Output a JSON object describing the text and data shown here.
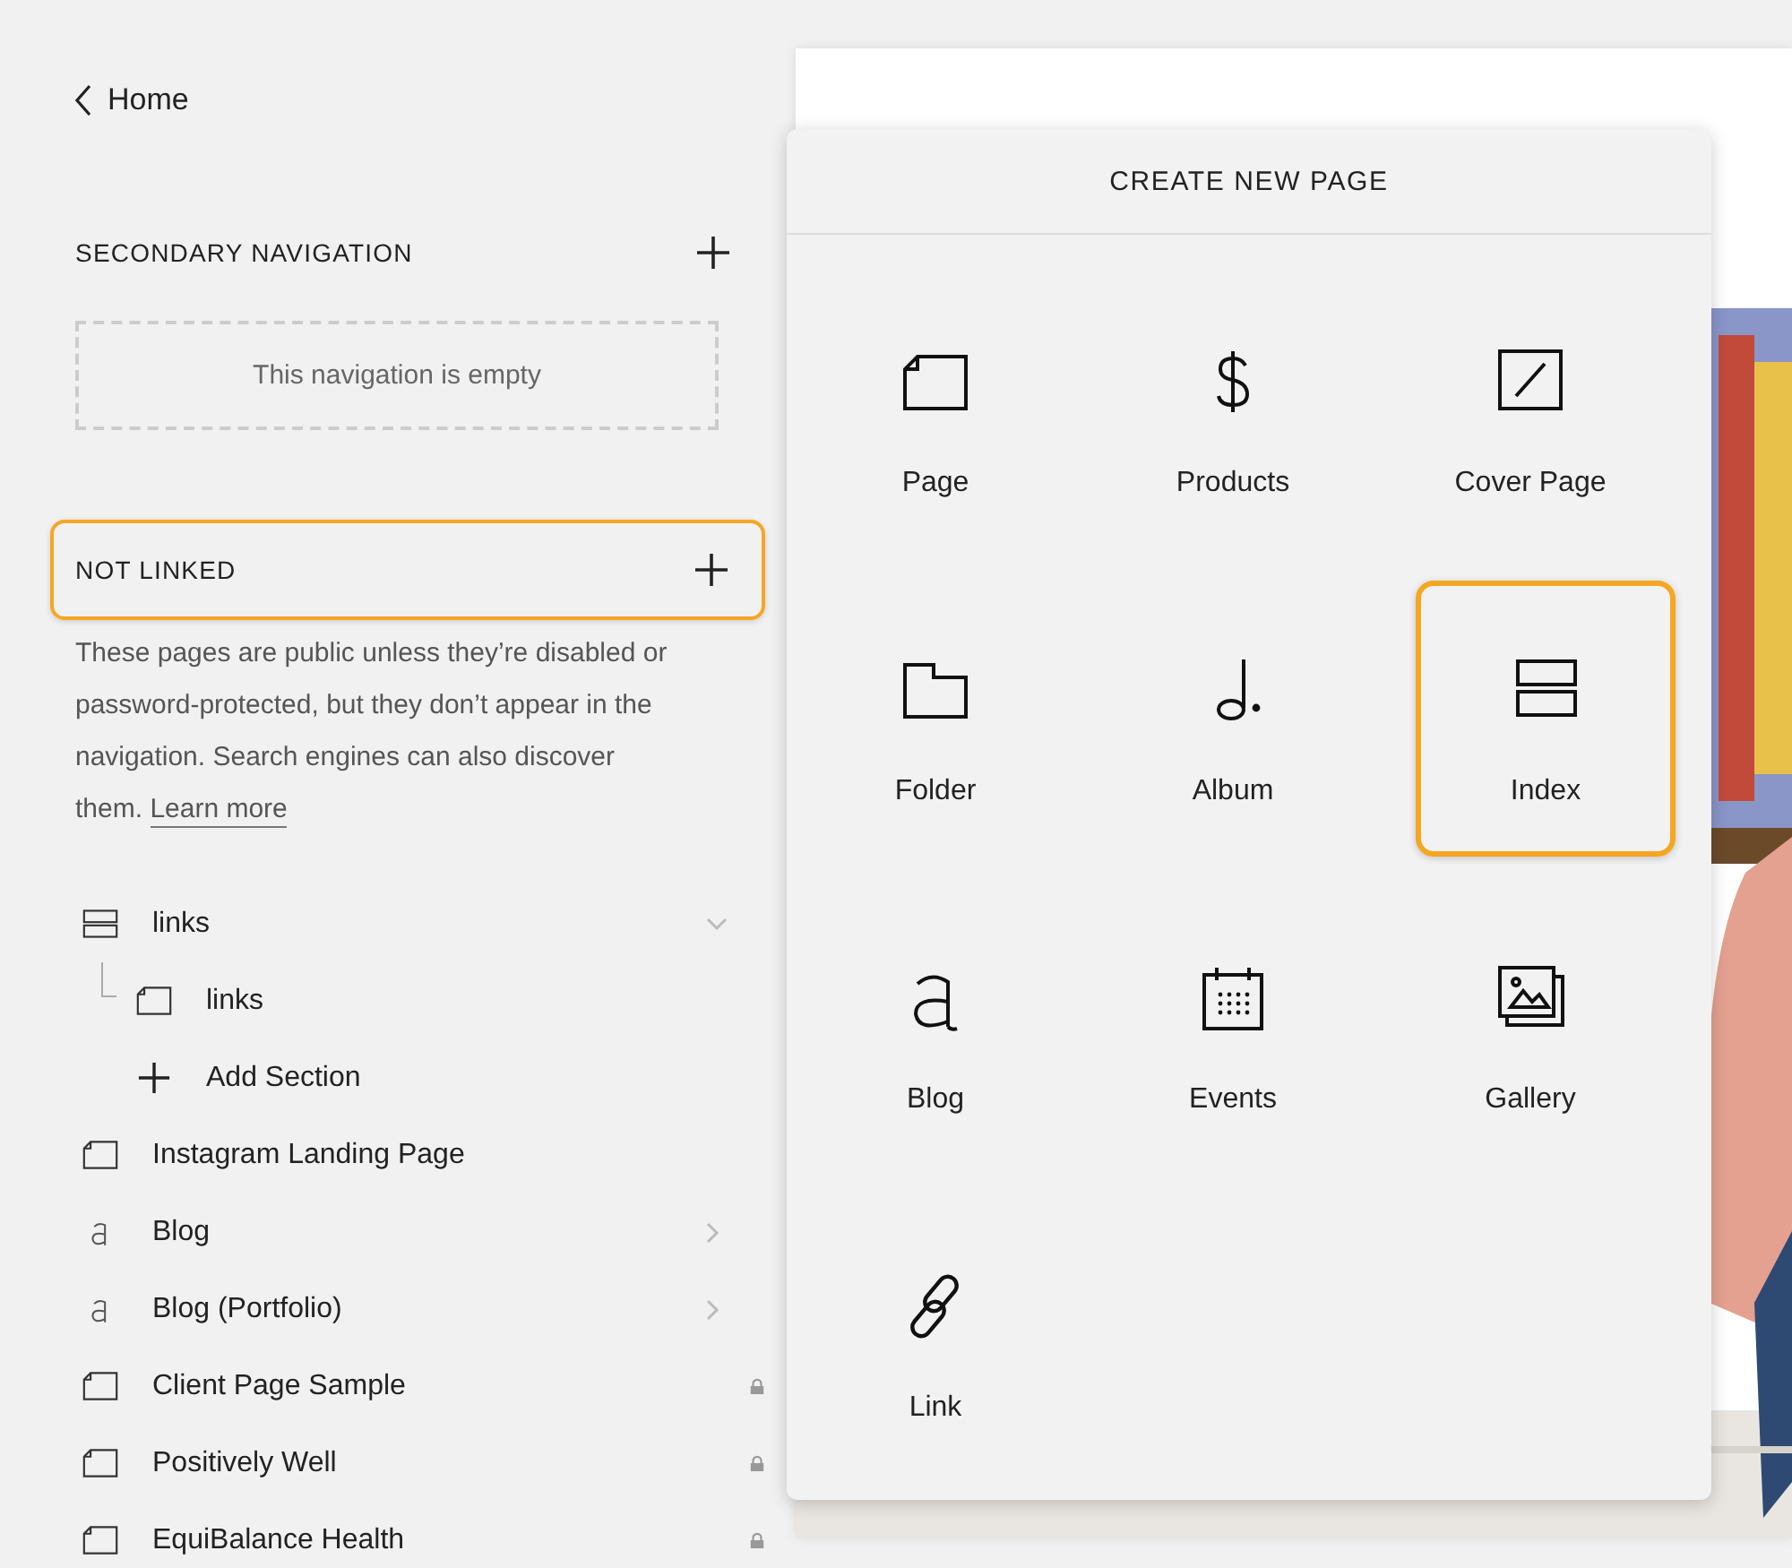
{
  "back": {
    "label": "Home"
  },
  "secondary_navigation": {
    "title": "SECONDARY NAVIGATION",
    "empty_message": "This navigation is empty"
  },
  "not_linked": {
    "title": "NOT LINKED",
    "highlighted": true,
    "description": "These pages are public unless they’re disabled or password-protected, but they don’t appear in the navigation. Search engines can also discover them.",
    "link": "Learn more"
  },
  "pages": [
    {
      "kind": "index",
      "label": "links",
      "expanded": true,
      "locked": false,
      "children": [
        {
          "kind": "page",
          "label": "links",
          "locked": false
        },
        {
          "kind": "add",
          "label": "Add Section"
        }
      ]
    },
    {
      "kind": "page",
      "label": "Instagram Landing Page",
      "locked": false
    },
    {
      "kind": "blog",
      "label": "Blog",
      "expanded": false,
      "locked": false
    },
    {
      "kind": "blog",
      "label": "Blog (Portfolio)",
      "expanded": false,
      "locked": false
    },
    {
      "kind": "page",
      "label": "Client Page Sample",
      "locked": true
    },
    {
      "kind": "page",
      "label": "Positively Well",
      "locked": true
    },
    {
      "kind": "page",
      "label": "EquiBalance Health",
      "locked": true
    }
  ],
  "create_new_page": {
    "title": "CREATE NEW PAGE",
    "options": [
      {
        "kind": "page",
        "label": "Page",
        "highlighted": false
      },
      {
        "kind": "products",
        "label": "Products",
        "highlighted": false
      },
      {
        "kind": "cover",
        "label": "Cover Page",
        "highlighted": false
      },
      {
        "kind": "folder",
        "label": "Folder",
        "highlighted": false
      },
      {
        "kind": "album",
        "label": "Album",
        "highlighted": false
      },
      {
        "kind": "index",
        "label": "Index",
        "highlighted": true
      },
      {
        "kind": "blog",
        "label": "Blog",
        "highlighted": false
      },
      {
        "kind": "events",
        "label": "Events",
        "highlighted": false
      },
      {
        "kind": "gallery",
        "label": "Gallery",
        "highlighted": false
      },
      {
        "kind": "link",
        "label": "Link",
        "highlighted": false
      }
    ]
  }
}
